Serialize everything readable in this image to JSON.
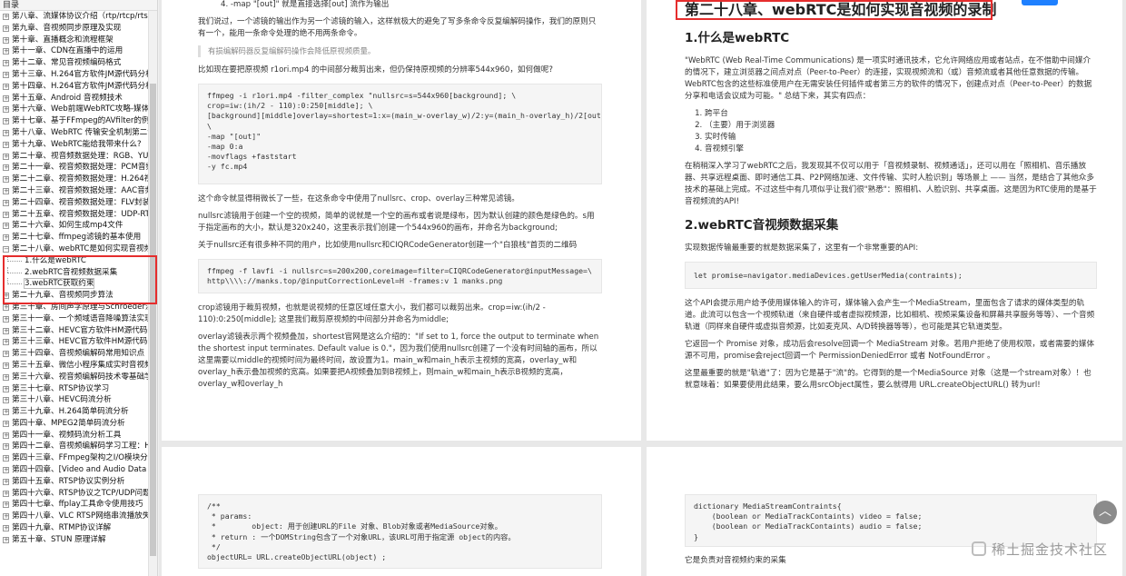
{
  "sidebar": {
    "title": "目录",
    "items": [
      {
        "label": "第八章、流媒体协议介绍（rtp/rtcp/rtsp/",
        "type": "chapter"
      },
      {
        "label": "第九章、音视频同步原理及实现",
        "type": "chapter"
      },
      {
        "label": "第十章、直播概念和流程框架",
        "type": "chapter"
      },
      {
        "label": "第十一章、CDN在直播中的运用",
        "type": "chapter"
      },
      {
        "label": "第十二章、常见音视频编码格式",
        "type": "chapter"
      },
      {
        "label": "第十三章、H.264官方软件JM源代码分析",
        "type": "chapter"
      },
      {
        "label": "第十四章、H.264官方软件JM源代码分析",
        "type": "chapter"
      },
      {
        "label": "第十五章、Android 音视频技术",
        "type": "chapter"
      },
      {
        "label": "第十六章、Web前端WebRTC攻略-媒体协",
        "type": "chapter"
      },
      {
        "label": "第十七章、基于FFmpeg的AVfilter的例子",
        "type": "chapter"
      },
      {
        "label": "第十八章、WebRTC 传输安全机制第二话",
        "type": "chapter"
      },
      {
        "label": "第十九章、WebRTC能给我带来什么?",
        "type": "chapter"
      },
      {
        "label": "第二十章、视音频数据处理：RGB、YUV",
        "type": "chapter"
      },
      {
        "label": "第二十一章、视音频数据处理：PCM音频",
        "type": "chapter"
      },
      {
        "label": "第二十二章、视音频数据处理：H.264视频",
        "type": "chapter"
      },
      {
        "label": "第二十三章、视音频数据处理：AAC音频",
        "type": "chapter"
      },
      {
        "label": "第二十四章、视音频数据处理：FLV封装格",
        "type": "chapter"
      },
      {
        "label": "第二十五章、视音频数据处理：UDP-RTP",
        "type": "chapter"
      },
      {
        "label": "第二十六章、如何生成mp4文件",
        "type": "chapter"
      },
      {
        "label": "第二十七章、ffmpeg滤镜的基本使用",
        "type": "chapter"
      },
      {
        "label": "第二十八章、webRTC是如何实现音视频",
        "type": "chapter",
        "expanded": true
      },
      {
        "label": "1.什么是webRTC",
        "type": "sub"
      },
      {
        "label": "2.webRTC音视频数据采集",
        "type": "sub"
      },
      {
        "label": "3.webRTC获取约束",
        "type": "sub",
        "active": true
      },
      {
        "label": "第二十九章、音视频同步算法",
        "type": "chapter"
      },
      {
        "label": "第三十章、房间声学原理与Schroeder混",
        "type": "chapter"
      },
      {
        "label": "第三十一章、一个频域语音降噪算法实现",
        "type": "chapter"
      },
      {
        "label": "第三十二章、HEVC官方软件HM源代码分",
        "type": "chapter"
      },
      {
        "label": "第三十三章、HEVC官方软件HM源代码分",
        "type": "chapter"
      },
      {
        "label": "第三十四章、音视频编解码常用知识点",
        "type": "chapter"
      },
      {
        "label": "第三十五章、微信小程序集成实时音视频",
        "type": "chapter"
      },
      {
        "label": "第三十六章、视音频编解码技术零基础学",
        "type": "chapter"
      },
      {
        "label": "第三十七章、RTSP协议学习",
        "type": "chapter"
      },
      {
        "label": "第三十八章、HEVC码流分析",
        "type": "chapter"
      },
      {
        "label": "第三十九章、H.264简单码流分析",
        "type": "chapter"
      },
      {
        "label": "第四十章、MPEG2简单码流分析",
        "type": "chapter"
      },
      {
        "label": "第四十一章、视频码流分析工具",
        "type": "chapter"
      },
      {
        "label": "第四十二章、音视频编解码学习工程：H.2",
        "type": "chapter"
      },
      {
        "label": "第四十三章、FFmpeg架构之I/O模块分析",
        "type": "chapter"
      },
      {
        "label": "第四十四章、[Video and Audio Data P",
        "type": "chapter"
      },
      {
        "label": "第四十五章、RTSP协议实例分析",
        "type": "chapter"
      },
      {
        "label": "第四十六章、RTSP协议之TCP/UDP问题",
        "type": "chapter"
      },
      {
        "label": "第四十七章、ffplay工具命令使用技巧",
        "type": "chapter"
      },
      {
        "label": "第四十八章、VLC RTSP网络串流播放失败",
        "type": "chapter"
      },
      {
        "label": "第四十九章、RTMP协议详解",
        "type": "chapter"
      },
      {
        "label": "第五十章、STUN 原理详解",
        "type": "chapter"
      }
    ]
  },
  "left_page": {
    "list_item_4": "4. -map \"[out]\" 就是直接选择[out] 流作为输出",
    "p1": "我们说过，一个滤镜的输出作为另一个滤镜的输入，这样就极大的避免了写多条命令反复编解码操作，我们的原则只有一个，能用一条命令处理的绝不用两条命令。",
    "quote": "有损编解码器反复编解码操作会降低原视频质量。",
    "p2": "比如现在要把原视频 r1ori.mp4 的中间部分裁剪出来，但仍保持原视频的分辨率544x960，如何做呢?",
    "code1": "ffmpeg -i r1ori.mp4 -filter_complex \"nullsrc=s=544x960[background]; \\\ncrop=iw:(ih/2 - 110):0:250[middle]; \\\n[background][middle]overlay=shortest=1:x=(main_w-overlay_w)/2:y=(main_h-overlay_h)/2[out]\"\n\\\n-map \"[out]\"\n-map 0:a\n-movflags +faststart\n-y fc.mp4",
    "p3": "这个命令就显得稍微长了一些，在这条命令中使用了nullsrc、crop、overlay三种常见滤镜。",
    "p4": "nullsrc滤镜用于创建一个空的视频，简单的说就是一个空的画布或者说是绿布，因为默认创建的颜色是绿色的。s用于指定画布的大小，默认是320x240，这里表示我们创建一个544x960的画布，并命名为background;",
    "p5": "关于nullsrc还有很多种不同的用户，比如使用nullsrc和CIQRCodeGenerator创建一个\"白狼栈\"首页的二维码",
    "code2": "ffmpeg -f lavfi -i nullsrc=s=200x200,coreimage=filter=CIQRCodeGenerator@inputMessage=\\\nhttp\\\\\\\\://manks.top/@inputCorrectionLevel=H -frames:v 1 manks.png",
    "p6": "crop滤镜用于裁剪视频，也就是说视频的任意区域任意大小，我们都可以裁剪出来。crop=iw:(ih/2 - 110):0:250[middle]; 这里我们裁剪原视频的中间部分并命名为middle;",
    "p7": "overlay滤镜表示两个视频叠加，shortest官网是这么介绍的：\"If set to 1, force the output to terminate when the shortest input terminates. Default value is 0.\"，因为我们使用nullsrc创建了一个没有时间轴的画布，所以这里需要以middle的视频时间为最终时间，故设置为1。main_w和main_h表示主视频的宽高，overlay_w和overlay_h表示叠加视频的宽高。如果要把A视频叠加到B视频上，则main_w和main_h表示B视频的宽高，overlay_w和overlay_h",
    "code3": "/**\n * params:\n *        object: 用于创建URL的File 对象、Blob对象或者MediaSource对象。\n * return : 一个DOMString包含了一个对象URL，该URL可用于指定源 object的内容。\n */\nobjectURL= URL.createObjectURL(object) ;"
  },
  "right_page": {
    "chapter_title": "第二十八章、webRTC是如何实现音视频的录制",
    "h_what": "1.什么是webRTC",
    "p1": "\"WebRTC (Web Real-Time Communications) 是一项实时通讯技术，它允许网络应用或者站点，在不借助中间媒介的情况下，建立浏览器之间点对点（Peer-to-Peer）的连接，实现视频流和（或）音频流或者其他任意数据的传输。WebRTC包含的这些标准使用户在无需安装任何插件或者第三方的软件的情况下，创建点对点（Peer-to-Peer）的数据分享和电话会议成为可能。\" 总结下来，其实有四点：",
    "list": [
      "跨平台",
      "（主要）用于浏览器",
      "实时传输",
      "音视频引擎"
    ],
    "p2": "在稍稍深入学习了webRTC之后，我发现其不仅可以用于「音视频录制、视频通话」，还可以用在「照相机、音乐播放器、共享远程桌面、即时通信工具、P2P网络加速、文件传输、实时人脸识别」等场景上 —— 当然，是结合了其他众多技术的基础上完成。不过这些中有几项似乎让我们很\"熟悉\"：照相机、人脸识别、共享桌面。这是因为RTC使用的是基于音视频流的API!",
    "h_collect": "2.webRTC音视频数据采集",
    "p3": "实现数据传输最重要的就是数据采集了，这里有一个非常重要的API:",
    "code1": "let promise=navigator.mediaDevices.getUserMedia(contraints);",
    "p4": "这个API会提示用户给予使用媒体输入的许可，媒体输入会产生一个MediaStream，里面包含了请求的媒体类型的轨道。此流可以包含一个视频轨道（来自硬件或者虚拟视频源，比如相机、视频采集设备和屏幕共享服务等等）、一个音频轨道（同样来自硬件或虚拟音频源，比如麦克风、A/D转换器等等），也可能是其它轨道类型。",
    "p5": "它返回一个 Promise 对象，成功后会resolve回调一个 MediaStream 对象。若用户拒绝了使用权限，或者需要的媒体源不可用，promise会reject回调一个 PermissionDeniedError 或者 NotFoundError 。",
    "p6": "这里最重要的就是\"轨道\"了：因为它是基于\"流\"的。它得到的是一个MediaSource 对象（这是一个stream对象）！也就意味着：如果要使用此结果，要么用srcObject属性，要么就得用 URL.createObjectURL() 转为url!",
    "code2": "dictionary MediaStreamContraints{\n    (boolean or MediaTrackContaints) video = false;\n    (boolean or MediaTrackContaints) audio = false;\n}",
    "p7": "它是负责对音视频约束的采集"
  },
  "watermark": "稀土掘金技术社区",
  "scroll_top_glyph": "︿",
  "colors": {
    "highlight": "#e52d2d",
    "accent": "#1e80ff"
  }
}
